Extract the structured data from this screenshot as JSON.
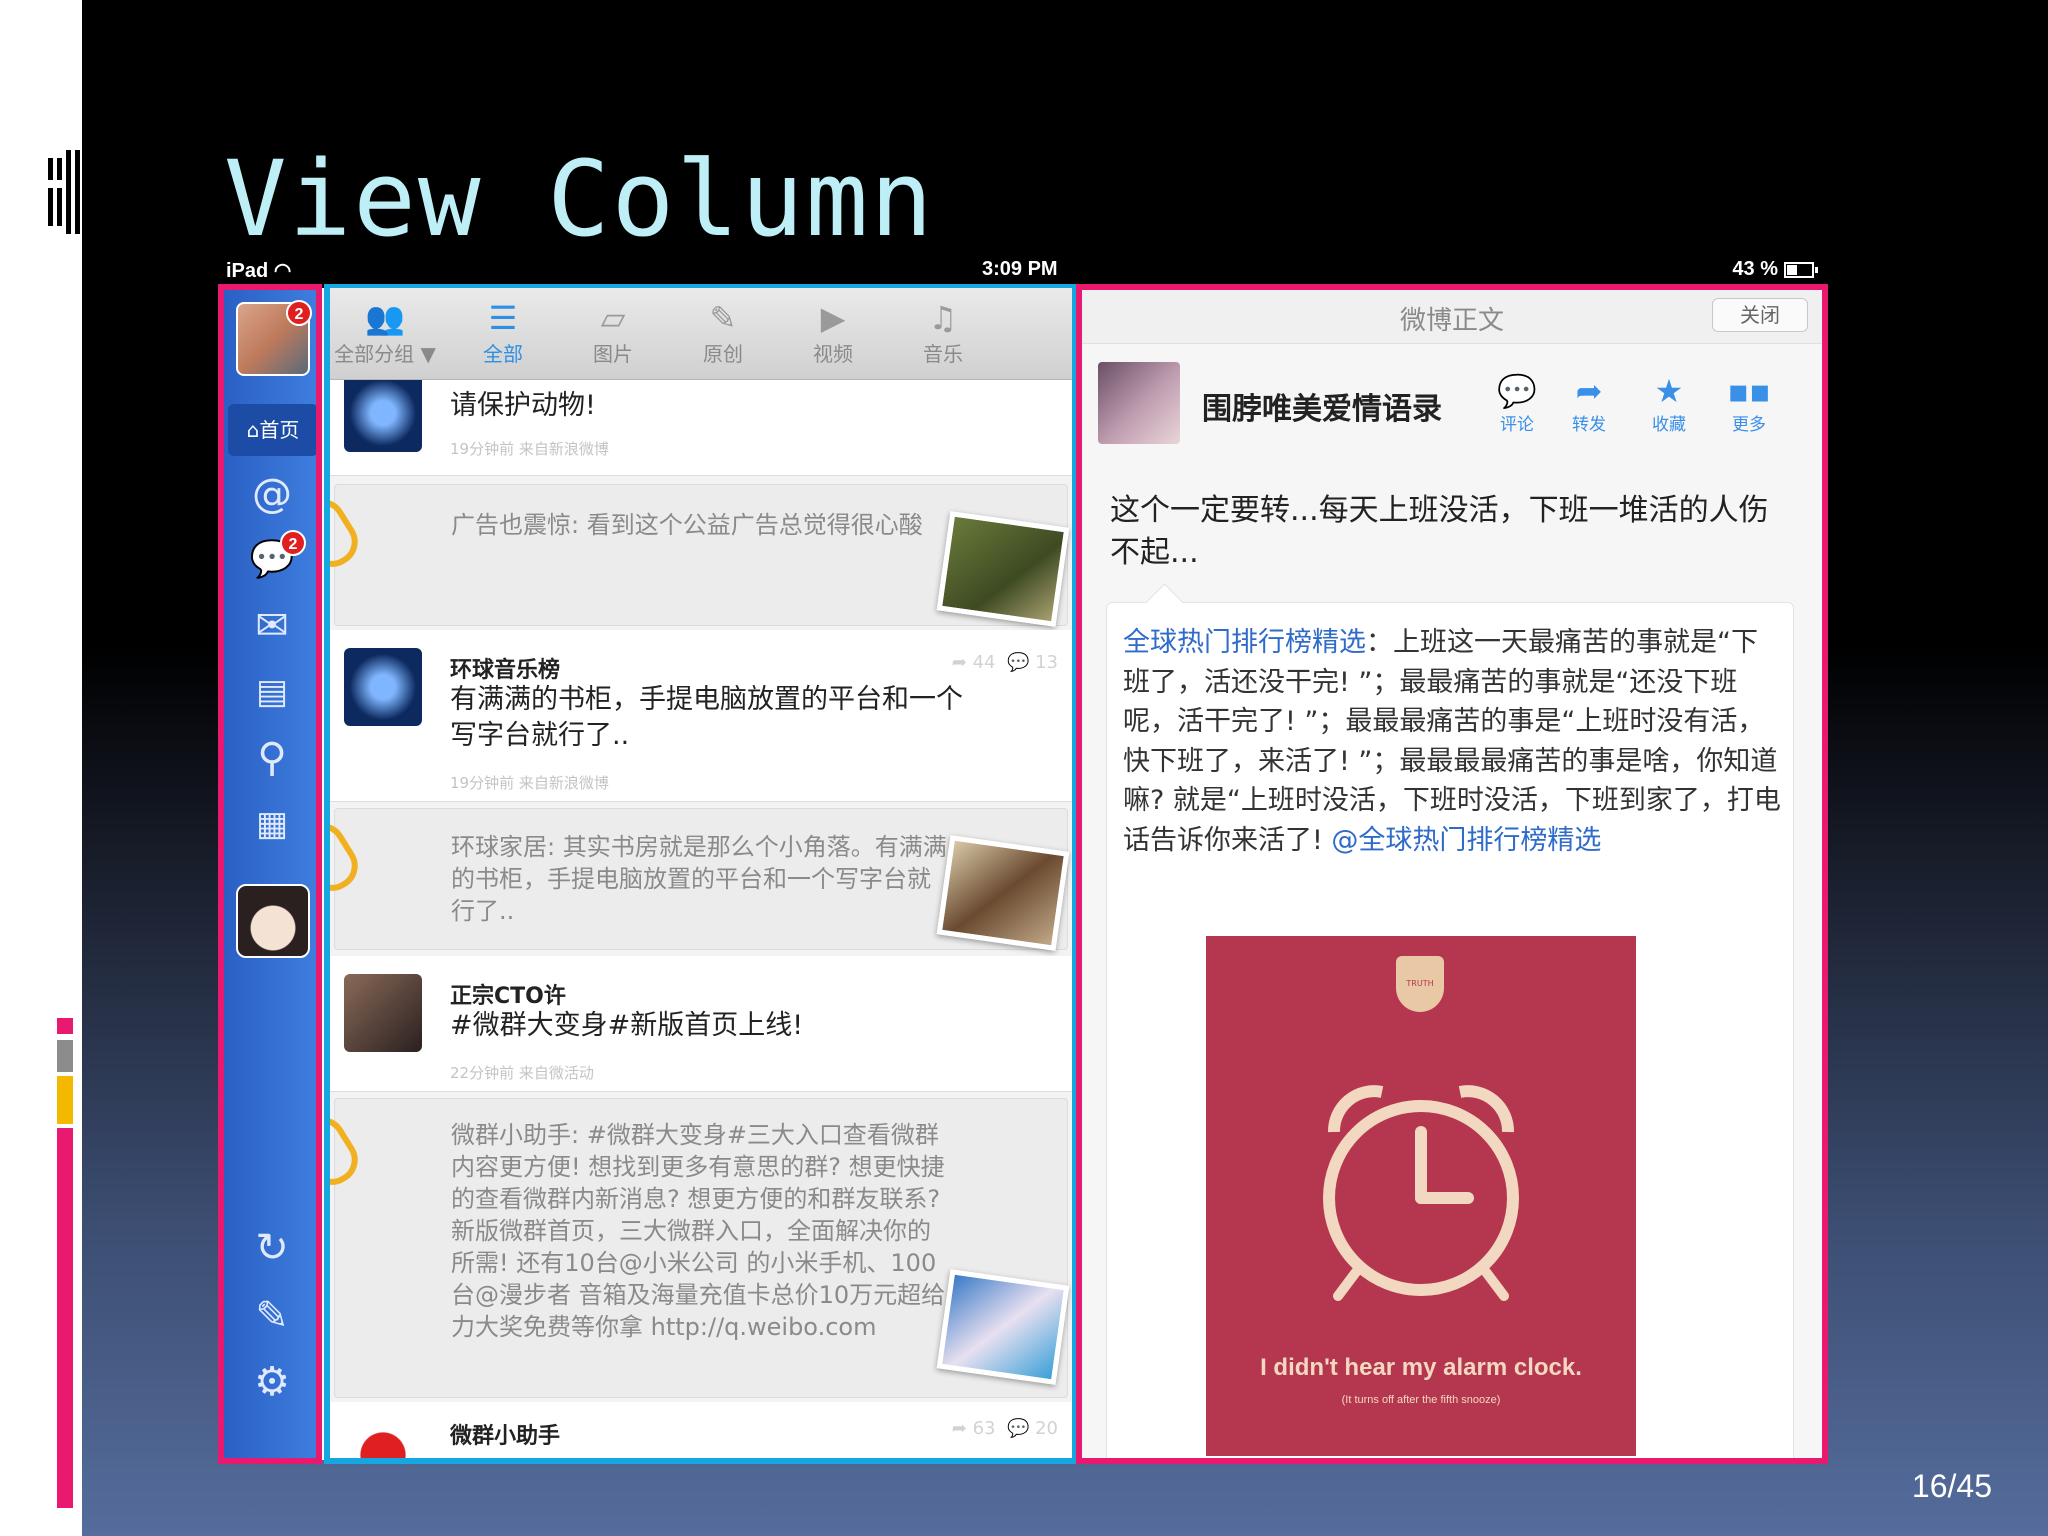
{
  "slide": {
    "title": "View Column",
    "page_number": "16/45"
  },
  "status_bar": {
    "device": "iPad",
    "time": "3:09 PM",
    "battery": "43 %"
  },
  "nav": {
    "avatar_badge": "2",
    "home_label": "首页",
    "comments_badge": "2",
    "icons": [
      "at-icon",
      "comment-icon",
      "mail-icon",
      "contact-card-icon",
      "search-icon",
      "apps-icon",
      "refresh-icon",
      "compose-icon",
      "gear-icon"
    ]
  },
  "toolbar": {
    "groups": "全部分组 ▼",
    "all": "全部",
    "pictures": "图片",
    "original": "原创",
    "video": "视频",
    "music": "音乐"
  },
  "feed": [
    {
      "text": "请保护动物!",
      "meta": "19分钟前  来自新浪微博",
      "quote": "广告也震惊: 看到这个公益广告总觉得很心酸"
    },
    {
      "author": "环球音乐榜",
      "text": "有满满的书柜，手提电脑放置的平台和一个写字台就行了..",
      "meta": "19分钟前  来自新浪微博",
      "reposts": "44",
      "comments": "13",
      "quote": "环球家居: 其实书房就是那么个小角落。有满满的书柜，手提电脑放置的平台和一个写字台就行了.."
    },
    {
      "author": "正宗CTO许",
      "text": "#微群大变身#新版首页上线!",
      "meta": "22分钟前  来自微活动",
      "quote": "微群小助手: #微群大变身#三大入口查看微群内容更方便! 想找到更多有意思的群? 想更快捷的查看微群内新消息? 想更方便的和群友联系? 新版微群首页，三大微群入口，全面解决你的所需! 还有10台@小米公司 的小米手机、100台@漫步者 音箱及海量充值卡总价10万元超给力大奖免费等你拿 http://q.weibo.com"
    },
    {
      "author": "微群小助手",
      "reposts": "63",
      "comments": "20"
    }
  ],
  "detail": {
    "header_title": "微博正文",
    "close_label": "关闭",
    "author": "围脖唯美爱情语录",
    "actions": {
      "comment": "评论",
      "repost": "转发",
      "favorite": "收藏",
      "more": "更多"
    },
    "body": "这个一定要转...每天上班没活，下班一堆活的人伤不起...",
    "quote_link": "全球热门排行榜精选",
    "quote_text": "：上班这一天最痛苦的事就是“下班了，活还没干完! ”；最最痛苦的事就是“还没下班呢，活干完了! ”；最最最痛苦的事是“上班时没有活，快下班了，来活了! ”；最最最最痛苦的事是啥，你知道嘛? 就是“上班时没活，下班时没活，下班到家了，打电话告诉你来活了! ",
    "quote_mention": "@全球热门排行榜精选",
    "poster_crest": "TRUTH BEHIND LIES",
    "poster_caption": "I didn't hear my alarm clock.",
    "poster_subcaption": "(It turns off after the fifth snooze)"
  },
  "colors": {
    "nav_box": "#e8196f",
    "mid_box": "#15a7e0",
    "detail_box": "#e8196f",
    "accent": "#2e8fe4",
    "title": "#bfeff6"
  }
}
